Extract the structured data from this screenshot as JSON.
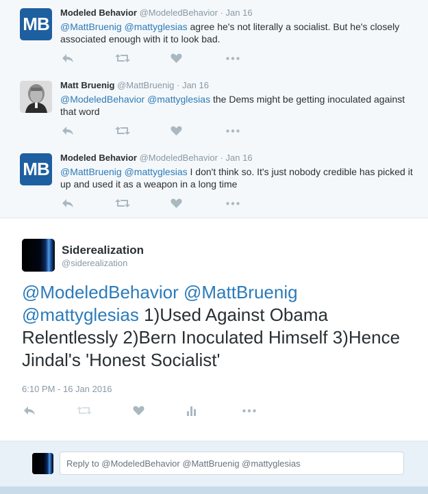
{
  "thread": [
    {
      "fullname": "Modeled Behavior",
      "handle": "@ModeledBehavior",
      "date": "· Jan 16",
      "mentions": [
        "@MattBruenig",
        "@mattyglesias"
      ],
      "text": "agree he's not literally a socialist. But he's closely associated enough with it to look bad.",
      "avatar_text": "MB"
    },
    {
      "fullname": "Matt Bruenig",
      "handle": "@MattBruenig",
      "date": "· Jan 16",
      "mentions": [
        "@ModeledBehavior",
        "@mattyglesias"
      ],
      "text": "the Dems might be getting inoculated against that word"
    },
    {
      "fullname": "Modeled Behavior",
      "handle": "@ModeledBehavior",
      "date": "· Jan 16",
      "mentions": [
        "@MattBruenig",
        "@mattyglesias"
      ],
      "text": "I don't think so. It's just nobody credible has picked it up and used it as a weapon in a long time",
      "avatar_text": "MB"
    }
  ],
  "main_tweet": {
    "fullname": "Siderealization",
    "handle": "@siderealization",
    "mention1": "@ModeledBehavior",
    "mention2": "@MattBruenig",
    "mention3": "@mattyglesias",
    "text": "1)Used Against Obama Relentlessly 2)Bern Inoculated Himself 3)Hence Jindal's 'Honest Socialist'",
    "timestamp": "6:10 PM - 16 Jan 2016"
  },
  "reply": {
    "placeholder": "Reply to @ModeledBehavior @MattBruenig @mattyglesias"
  },
  "colors": {
    "link": "#2b7bb9",
    "muted": "#8899a6",
    "icon": "#aab8c2",
    "mb_avatar": "#1e5fa0"
  },
  "icons": [
    "reply-icon",
    "retweet-icon",
    "like-icon",
    "more-icon",
    "analytics-icon"
  ]
}
